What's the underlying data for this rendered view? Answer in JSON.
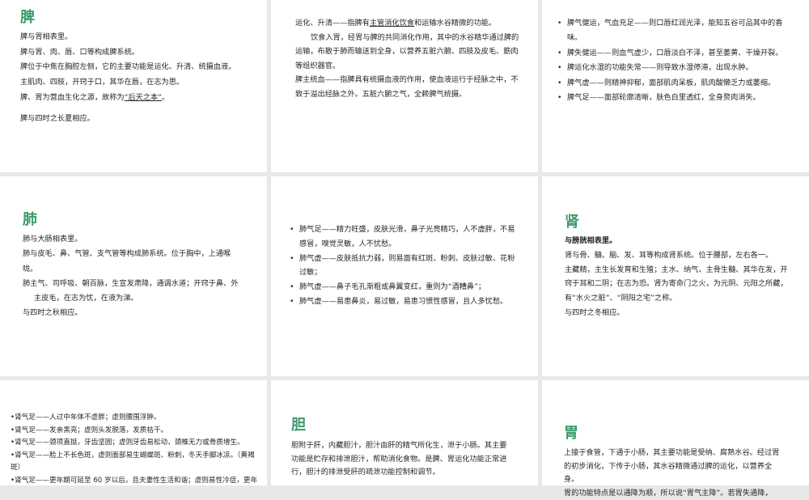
{
  "slides": [
    {
      "id": "s1",
      "title": "脾",
      "lines": [
        {
          "t": "脾与胃相表里。"
        },
        {
          "t": "脾与胃、肉、唇、口等构成脾系统。"
        },
        {
          "t": "脾位于中焦在胸腔左侧，它的主要功能是运化、升清、统摄血液。"
        },
        {
          "t": "主肌肉、四肢，开窍于口，其华在唇，在志为思。"
        },
        {
          "t": "脾、胃为营血生化之源，故称为",
          "u": "“后天之本”",
          "post": "。"
        },
        {
          "t": "脾与四时之长夏相应。",
          "cls": "gap"
        }
      ]
    },
    {
      "id": "s2",
      "title": "",
      "lines": [
        {
          "t": "运化、升清——指脾有",
          "u": "主管消化饮食",
          "post": "和运输水谷精微的功能。"
        },
        {
          "t": "饮食入胃，经胃与脾的共同消化作用，其中的水谷精华通过脾的运输，布散于肺而输送到全身，以营养五脏六腑、四肢及皮毛、筋肉等组织器官。",
          "cls": "indent"
        },
        {
          "t": "脾主统血——指脾具有统摄血液的作用，使血液运行于经脉之中，不致于溢出经脉之外。五脏六腑之气，全赖脾气统摄。"
        }
      ]
    },
    {
      "id": "s3",
      "title": "",
      "lines": [
        {
          "t": "脾气健运，气血充足——则口唇红润光泽，能知五谷可品其中的香味。",
          "cls": "bullet"
        },
        {
          "t": "脾失健运——则血气虚少，口唇淡白不泽，甚至萎黄、干燥开裂。",
          "cls": "bullet"
        },
        {
          "t": "脾运化水湿的功能失常——则导致水湿停滞，出现水肿。",
          "cls": "bullet"
        },
        {
          "t": "脾气虚——则精神抑郁，面部肌肉呆板，肌肉酸懒乏力或萎缩。",
          "cls": "bullet"
        },
        {
          "t": "  脾气足——面部轮廓清晰，肤色白里透红，全身赘肉消失。",
          "cls": "bullet"
        }
      ]
    },
    {
      "id": "s4",
      "title": "肺",
      "lines": [
        {
          "t": "肺与大肠相表里。"
        },
        {
          "t": "肺与皮毛、鼻、气管、支气管等构成肺系统。位于胸中，上通喉咙。"
        },
        {
          "t": "肺主气、司呼吸、朝百脉，生宣发肃降，通调水道；开窍于鼻、外主皮毛，在志为忧，在液为涕。",
          "cls": "hang"
        },
        {
          "t": "与四时之秋相应。"
        }
      ]
    },
    {
      "id": "s5",
      "title": "",
      "lines": [
        {
          "t": "肺气足——精力旺盛，皮肤光滑，鼻子光亮精巧，人不虚胖，不易感冒，嗅觉灵敏，人不忧愁。",
          "cls": "bullet"
        },
        {
          "t": "肺气虚——皮肤抵抗力弱，则易面有红斑、粉刺、皮肤过敏、花粉过敏；",
          "cls": "bullet"
        },
        {
          "t": "肺气虚——鼻子毛孔渐粗或鼻翼变红，重则为“酒糟鼻”；",
          "cls": "bullet"
        },
        {
          "t": "肺气虚——易患鼻炎，易过敏，易患习惯性感冒，且人多忧愁。",
          "cls": "bullet"
        }
      ]
    },
    {
      "id": "s6",
      "title": "肾",
      "lines": [
        {
          "t": "与膀胱相表里。",
          "cls": "bold"
        },
        {
          "t": "肾与骨、髓、脑、发、耳等构成肾系统。位于腰部，左右各一。"
        },
        {
          "t": "主藏精，主生长发育和生殖；主水、纳气、主骨生髓、其华在发，开窍于耳和二阴；在志为恐。肾为寄命门之火，为元阴、元阳之所藏，有“水火之脏”、“阴阳之宅”之称。"
        },
        {
          "t": "与四时之冬相应。"
        }
      ]
    },
    {
      "id": "s7",
      "title": "",
      "lines": [
        {
          "t": "肾气足——人过中年体不虚胖；虚则腰围浮肿。",
          "cls": "dot"
        },
        {
          "t": "肾气足——发亲黑亮；虚则头发脱落，发质枯干。",
          "cls": "dot"
        },
        {
          "t": "肾气足——颈项直挺，牙齿坚固；虚则牙齿易松动，颈椎无力或骨质增生。",
          "cls": "dot"
        },
        {
          "t": "肾气足——脸上不长色斑，虚则面部易生蝴蝶斑、粉刺，冬天手脚冰凉。（黄褐斑）",
          "cls": "dot"
        },
        {
          "t": "肾气足——更年期可延至 60 岁以后，且夫妻性生活和谐；虚则易性冷症，更年",
          "cls": "dot"
        }
      ]
    },
    {
      "id": "s8",
      "title": "胆",
      "lines": [
        {
          "t": "胆附于肝，内藏胆汁，胆汁由肝的精气所化生，泄于小肠。其主要功能是贮存和排泄胆汁，帮助消化食物。是脾、胃运化功能正常进行，胆汁的排泄受肝的疏泄功能控制和调节。"
        }
      ]
    },
    {
      "id": "s9",
      "title": "胃",
      "lines": [
        {
          "t": "上接于食管，下通于小肠，其主要功能是受纳、腐熟水谷。经过胃的初步消化，下传于小肠，其水谷精微通过脾的运化，以营养全身。"
        },
        {
          "t": "胃的功能特点是以通降为顺，所以说“胃气主降”。若胃失通降，"
        }
      ]
    }
  ]
}
